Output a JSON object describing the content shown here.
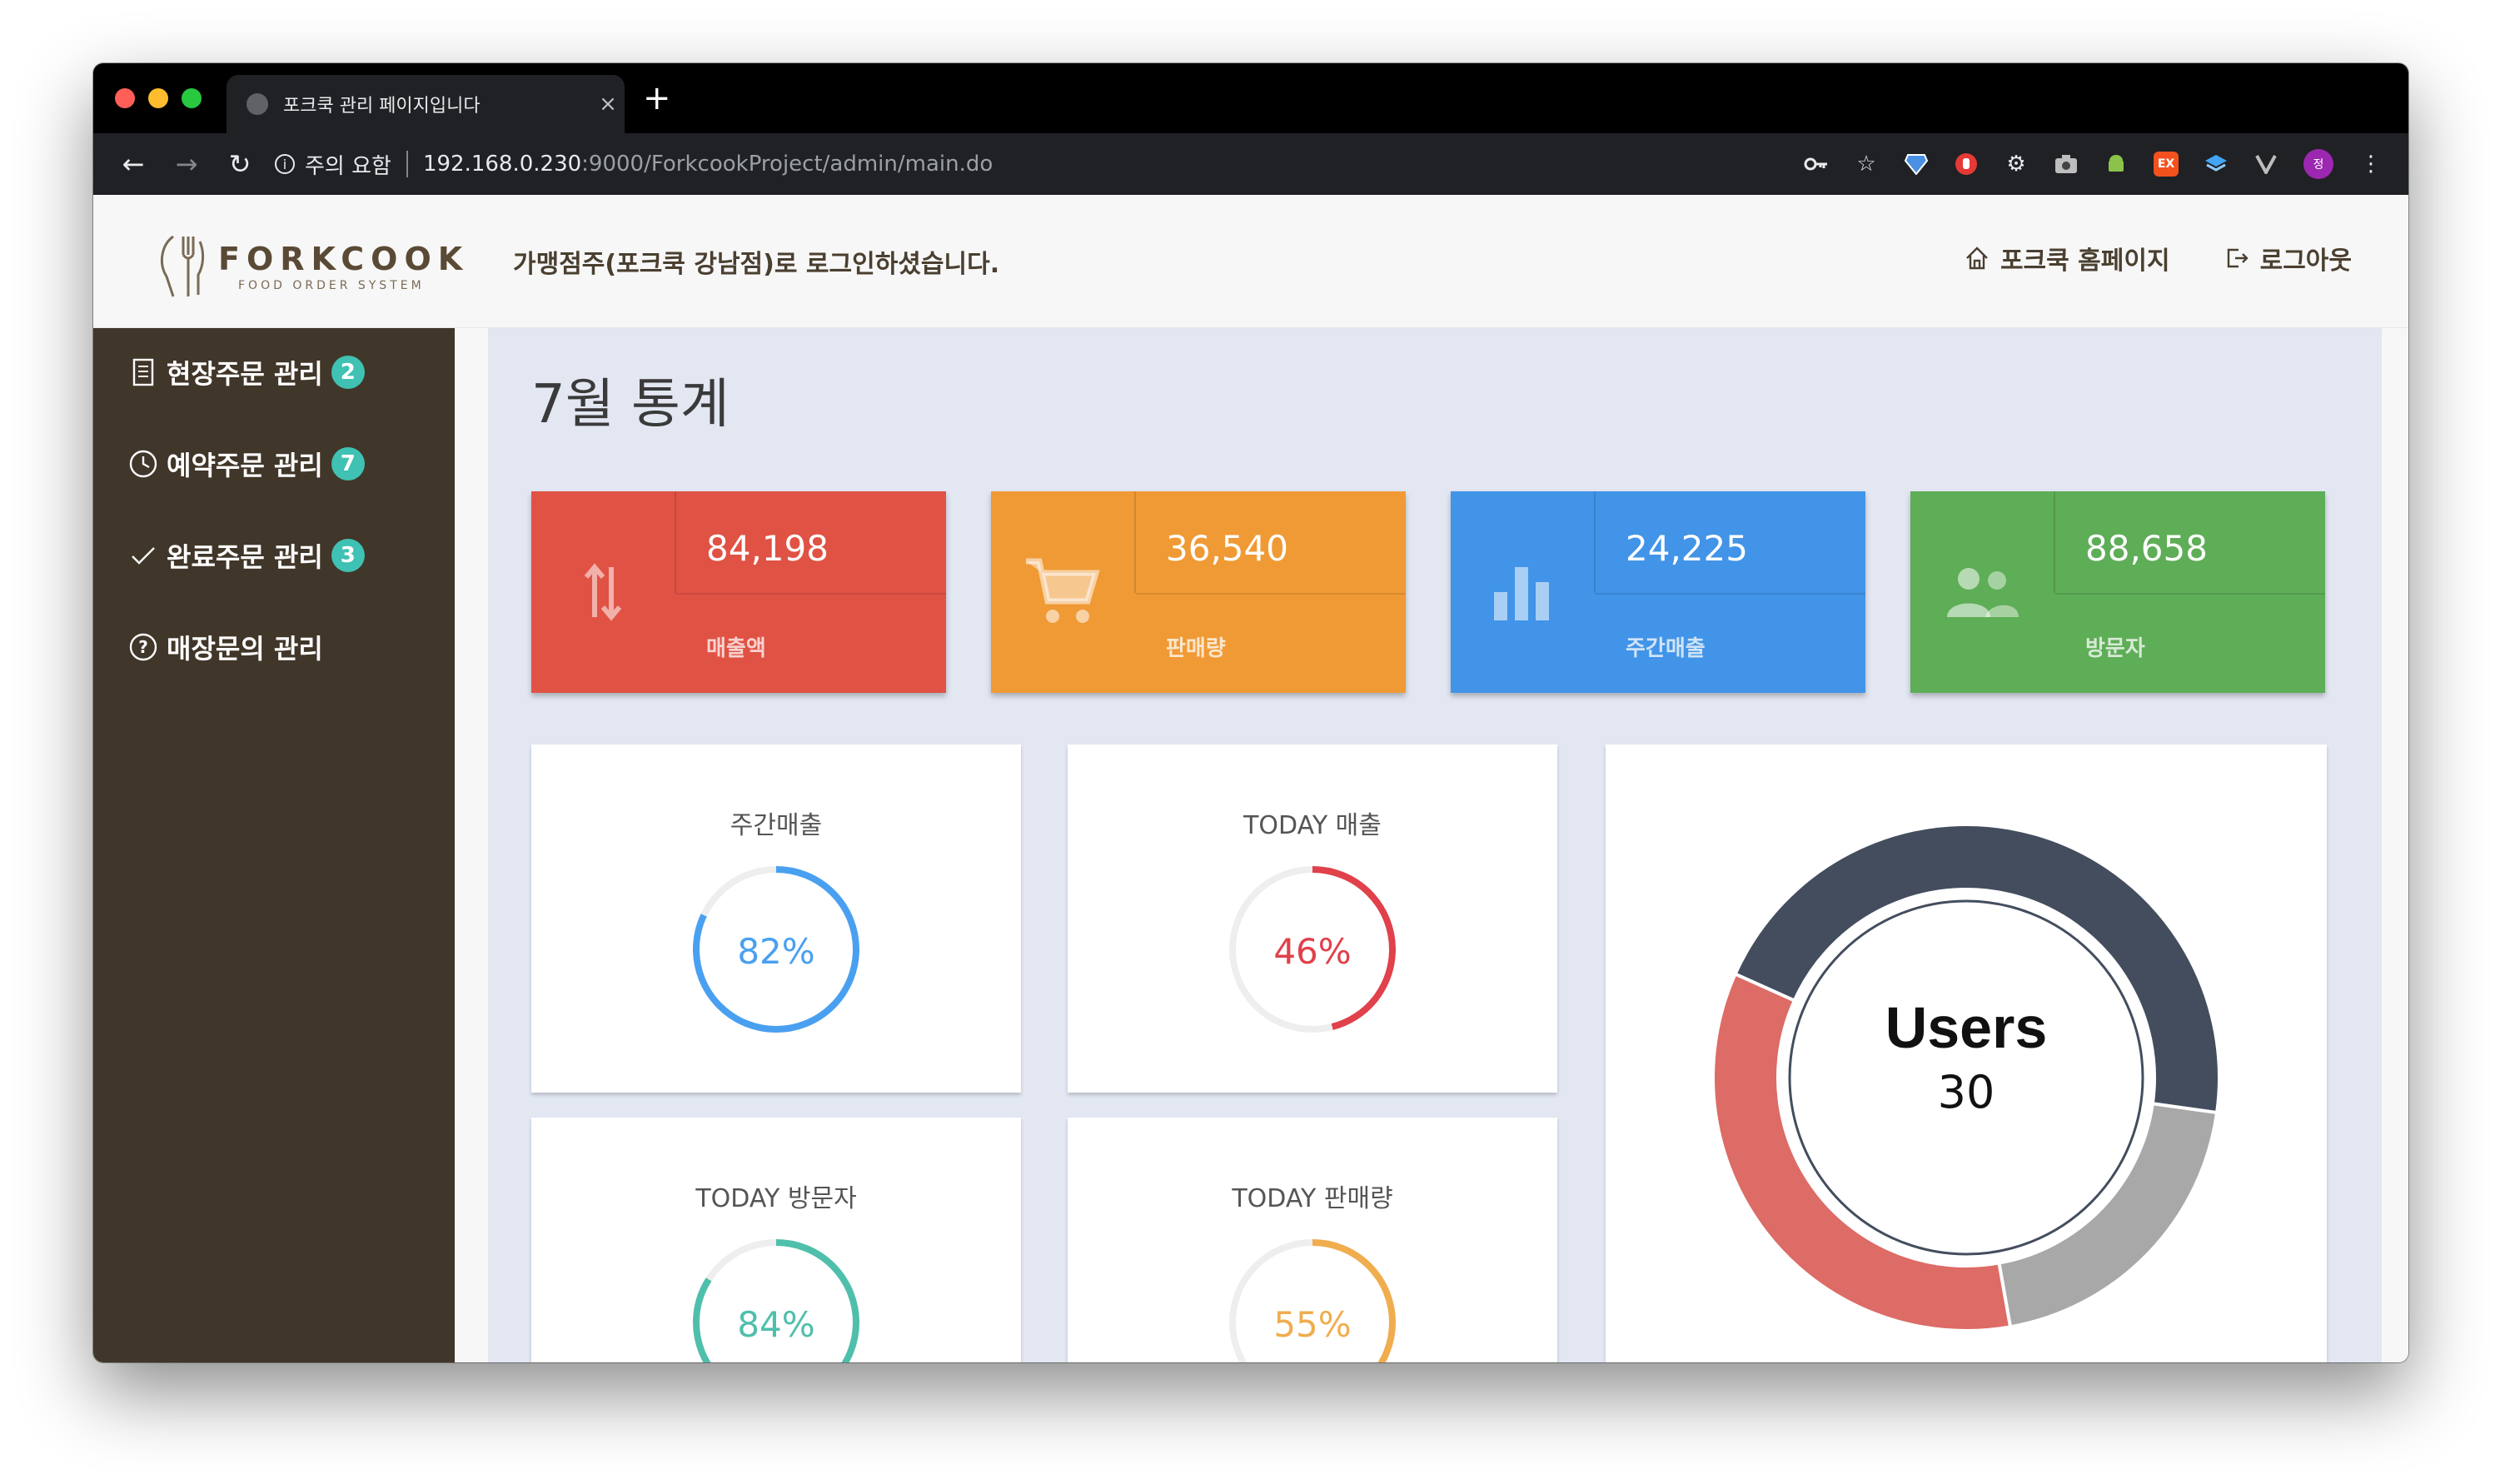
{
  "browser": {
    "tab_title": "포크쿡 관리 페이지입니다",
    "tab_close": "×",
    "new_tab": "+",
    "security_label": "주의 요함",
    "url_host": "192.168.0.230",
    "url_rest": ":9000/ForkcookProject/admin/main.do",
    "profile_initial": "정"
  },
  "header": {
    "logo_name": "FORKCOOK",
    "logo_sub": "FOOD ORDER SYSTEM",
    "login_message": "가맹점주(포크쿡 강남점)로 로그인하셨습니다.",
    "home_link": "포크쿡 홈페이지",
    "logout_link": "로그아웃"
  },
  "sidebar": {
    "items": [
      {
        "label": "현장주문 관리",
        "badge": "2",
        "icon": "document-icon"
      },
      {
        "label": "예약주문 관리",
        "badge": "7",
        "icon": "clock-icon"
      },
      {
        "label": "완료주문 관리",
        "badge": "3",
        "icon": "check-icon"
      },
      {
        "label": "매장문의 관리",
        "badge": null,
        "icon": "question-icon"
      }
    ]
  },
  "main": {
    "title": "7월 통계",
    "stats": [
      {
        "value": "84,198",
        "label": "매출액",
        "color": "#e05244",
        "icon": "arrows-updown-icon"
      },
      {
        "value": "36,540",
        "label": "판매량",
        "color": "#f09a35",
        "icon": "cart-icon"
      },
      {
        "value": "24,225",
        "label": "주간매출",
        "color": "#4194e8",
        "icon": "bar-chart-icon"
      },
      {
        "value": "88,658",
        "label": "방문자",
        "color": "#5ead57",
        "icon": "users-icon"
      }
    ],
    "gauges": [
      {
        "title": "주간매출",
        "percent_text": "82%",
        "fraction": 0.82,
        "color": "#4aa0f0"
      },
      {
        "title": "TODAY 매출",
        "percent_text": "46%",
        "fraction": 0.46,
        "color": "#e0414a"
      },
      {
        "title": "TODAY 방문자",
        "percent_text": "84%",
        "fraction": 0.84,
        "color": "#4fbfab"
      },
      {
        "title": "TODAY 판매량",
        "percent_text": "55%",
        "fraction": 0.55,
        "color": "#f0ad4e"
      }
    ],
    "users": {
      "label": "Users",
      "count": "30",
      "segments": [
        {
          "fraction": 0.455,
          "color": "#434d5e"
        },
        {
          "fraction": 0.2,
          "color": "#a8a8a8"
        },
        {
          "fraction": 0.345,
          "color": "#dd6b66"
        }
      ]
    },
    "fab_icon": "menu-icon"
  }
}
